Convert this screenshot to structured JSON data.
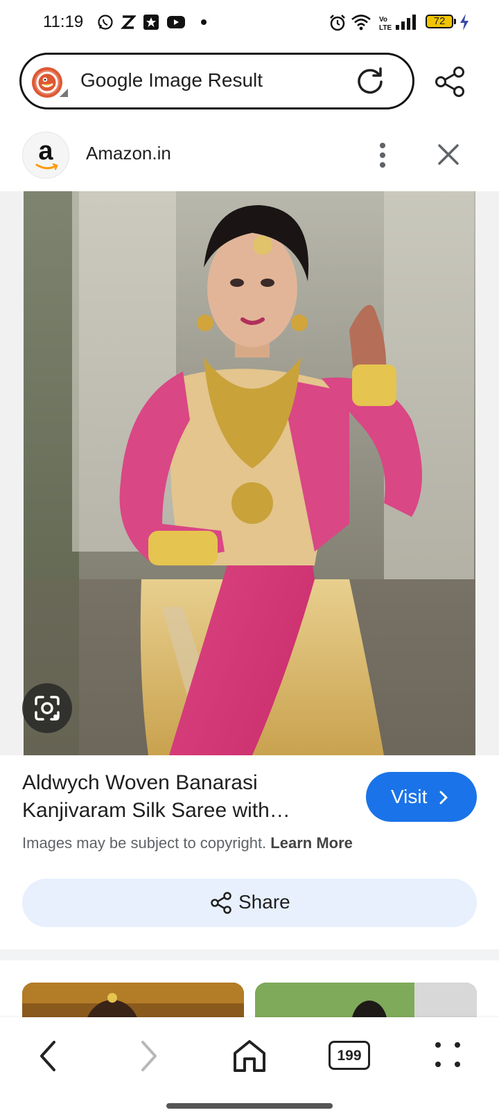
{
  "status_bar": {
    "time": "11:19",
    "battery": "72",
    "icons": [
      "whatsapp-icon",
      "z-app-icon",
      "star-app-icon",
      "youtube-icon",
      "dot-icon",
      "alarm-icon",
      "wifi-icon",
      "volte-icon",
      "signal-icon",
      "battery-icon",
      "charging-icon"
    ]
  },
  "address_bar": {
    "title": "Google Image Result"
  },
  "source": {
    "logo_letter": "a",
    "name": "Amazon.in"
  },
  "result": {
    "title": "Aldwych Woven Banarasi Kanjivaram Silk Saree with…",
    "visit_label": "Visit",
    "copyright_text": "Images may be subject to copyright.",
    "learn_more": "Learn More",
    "share_label": "Share"
  },
  "navigation": {
    "tab_count": "199"
  },
  "colors": {
    "accent": "#1a73e8",
    "share_bg": "#e8f0fe",
    "duckduckgo": "#de5833",
    "battery": "#f0c400"
  }
}
